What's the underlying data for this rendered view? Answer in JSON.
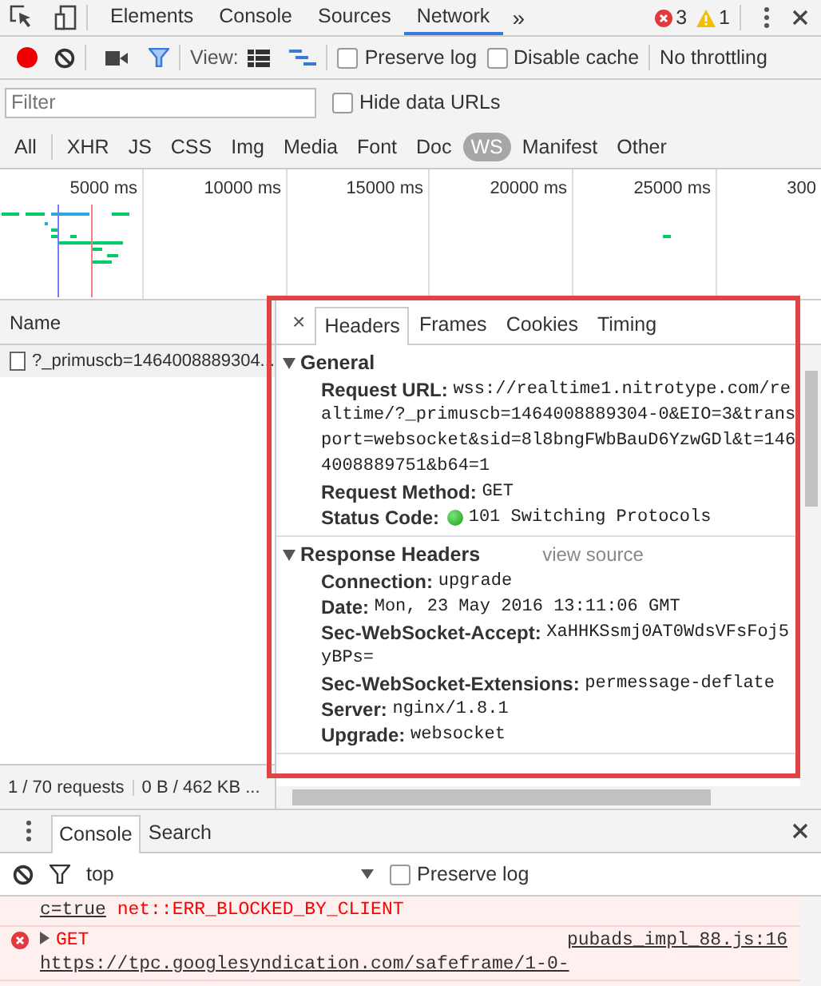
{
  "main_tabs": [
    {
      "label": "Elements",
      "selected": false
    },
    {
      "label": "Console",
      "selected": false
    },
    {
      "label": "Sources",
      "selected": false
    },
    {
      "label": "Network",
      "selected": true
    }
  ],
  "more_tabs": "»",
  "error_count": "3",
  "warning_count": "1",
  "toolbar": {
    "recording": true,
    "view_label": "View:",
    "preserve_log": {
      "label": "Preserve log",
      "checked": false
    },
    "disable_cache": {
      "label": "Disable cache",
      "checked": false
    },
    "throttling": "No throttling"
  },
  "filter": {
    "placeholder": "Filter"
  },
  "hide_data_urls": {
    "label": "Hide data URLs",
    "checked": false
  },
  "type_filters": [
    {
      "label": "All",
      "selected": false
    },
    {
      "label": "XHR",
      "selected": false
    },
    {
      "label": "JS",
      "selected": false
    },
    {
      "label": "CSS",
      "selected": false
    },
    {
      "label": "Img",
      "selected": false
    },
    {
      "label": "Media",
      "selected": false
    },
    {
      "label": "Font",
      "selected": false
    },
    {
      "label": "Doc",
      "selected": false
    },
    {
      "label": "WS",
      "selected": true
    },
    {
      "label": "Manifest",
      "selected": false
    },
    {
      "label": "Other",
      "selected": false
    }
  ],
  "overview": {
    "ticks": [
      "5000 ms",
      "10000 ms",
      "15000 ms",
      "20000 ms",
      "25000 ms",
      "300"
    ]
  },
  "requests": {
    "column": "Name",
    "rows": [
      {
        "name": "?_primuscb=1464008889304...",
        "selected": true
      }
    ]
  },
  "details": {
    "close": "×",
    "tabs": [
      {
        "label": "Headers",
        "selected": true
      },
      {
        "label": "Frames",
        "selected": false
      },
      {
        "label": "Cookies",
        "selected": false
      },
      {
        "label": "Timing",
        "selected": false
      }
    ],
    "sections": [
      {
        "title": "General",
        "expanded": true,
        "fields": [
          {
            "kind": "plain",
            "key": "Request URL:",
            "value": "wss://realtime1.nitrotype.com/realtime/?_primuscb=1464008889304-0&EIO=3&transport=websocket&sid=8l8bngFWbBauD6YzwGDl&t=1464008889751&b64=1"
          },
          {
            "kind": "plain",
            "key": "Request Method:",
            "value": "GET"
          },
          {
            "kind": "status",
            "key": "Status Code:",
            "value": "101 Switching Protocols"
          }
        ]
      },
      {
        "title": "Response Headers",
        "expanded": true,
        "link": "view source",
        "fields": [
          {
            "kind": "plain",
            "key": "Connection:",
            "value": "upgrade"
          },
          {
            "kind": "plain",
            "key": "Date:",
            "value": "Mon, 23 May 2016 13:11:06 GMT"
          },
          {
            "kind": "plain",
            "key": "Sec-WebSocket-Accept:",
            "value": "XaHHKSsmj0AT0WdsVFsFoj5yBPs="
          },
          {
            "kind": "plain",
            "key": "Sec-WebSocket-Extensions:",
            "value": "permessage-deflate"
          },
          {
            "kind": "plain",
            "key": "Server:",
            "value": "nginx/1.8.1"
          },
          {
            "kind": "plain",
            "key": "Upgrade:",
            "value": "websocket"
          }
        ]
      }
    ]
  },
  "status_bar": {
    "requests": "1 / 70 requests",
    "transferred": "0 B / 462 KB ..."
  },
  "drawer": {
    "tabs": [
      {
        "label": "Console",
        "selected": true
      },
      {
        "label": "Search",
        "selected": false
      }
    ],
    "context": "top",
    "preserve_log": {
      "label": "Preserve log",
      "checked": false
    },
    "messages": [
      {
        "kind": "continuation",
        "link": "c=true",
        "text": "net::ERR_BLOCKED_BY_CLIENT"
      },
      {
        "kind": "error",
        "method": "GET",
        "source": "pubads_impl_88.js:16",
        "link": "https://tpc.googlesyndication.com/safeframe/1-0-"
      }
    ]
  }
}
